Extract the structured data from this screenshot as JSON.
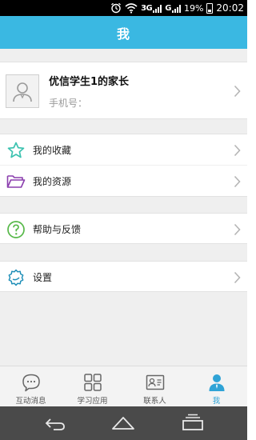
{
  "status_bar": {
    "network": "3G",
    "network2": "G",
    "battery": "19%",
    "time": "20:02"
  },
  "header": {
    "title": "我"
  },
  "profile": {
    "name": "优信学生1的家长",
    "phone_label": "手机号："
  },
  "menu": {
    "favorites": "我的收藏",
    "resources": "我的资源",
    "help": "帮助与反馈",
    "settings": "设置"
  },
  "tabs": [
    {
      "label": "互动消息",
      "icon": "chat-bubble-icon",
      "active": false
    },
    {
      "label": "学习应用",
      "icon": "grid-icon",
      "active": false
    },
    {
      "label": "联系人",
      "icon": "contact-card-icon",
      "active": false
    },
    {
      "label": "我",
      "icon": "person-icon",
      "active": true
    }
  ],
  "colors": {
    "accent": "#3ab8e2",
    "favorites_icon": "#3cc2b0",
    "resources_icon": "#8b3fae",
    "help_icon": "#56b848",
    "settings_icon": "#1f8fb8",
    "active_tab": "#2fa3d6"
  }
}
